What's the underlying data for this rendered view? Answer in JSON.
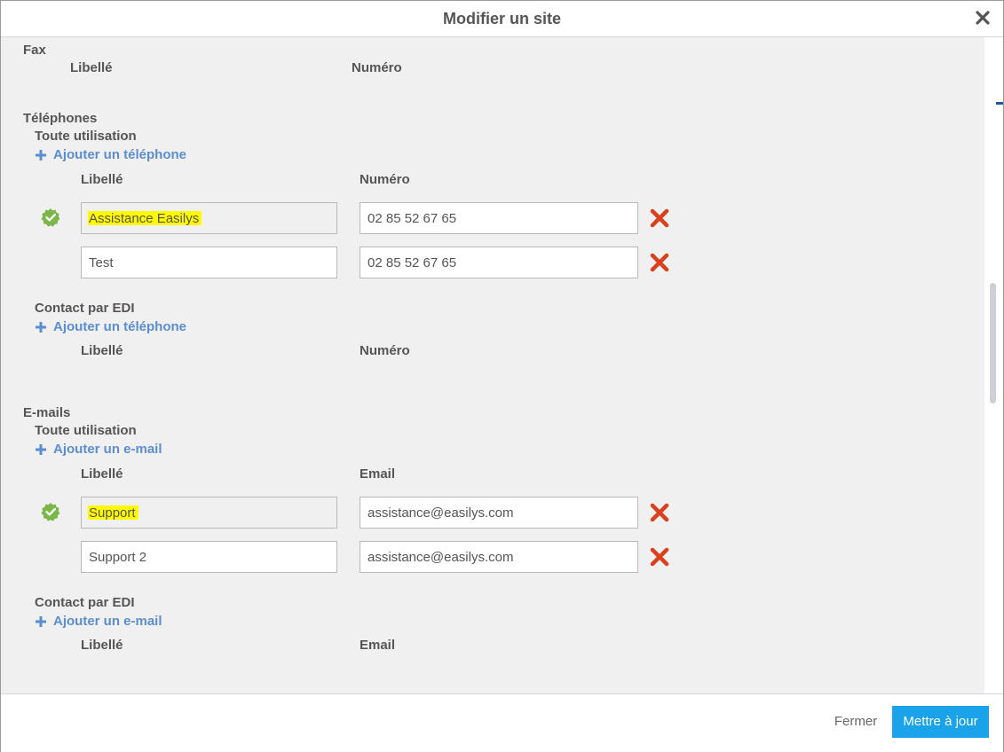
{
  "modal": {
    "title": "Modifier un site"
  },
  "fax": {
    "section": "Fax",
    "col_label": "Libellé",
    "col_number": "Numéro"
  },
  "phones": {
    "section": "Téléphones",
    "general": {
      "title": "Toute utilisation",
      "add": "Ajouter un téléphone",
      "col_label": "Libellé",
      "col_number": "Numéro",
      "rows": [
        {
          "label": "Assistance Easilys",
          "number": "02 85 52 67 65",
          "primary": true
        },
        {
          "label": "Test",
          "number": "02 85 52 67 65",
          "primary": false
        }
      ]
    },
    "edi": {
      "title": "Contact par EDI",
      "add": "Ajouter un téléphone",
      "col_label": "Libellé",
      "col_number": "Numéro"
    }
  },
  "emails": {
    "section": "E-mails",
    "general": {
      "title": "Toute utilisation",
      "add": "Ajouter un e-mail",
      "col_label": "Libellé",
      "col_email": "Email",
      "rows": [
        {
          "label": "Support",
          "email": "assistance@easilys.com",
          "primary": true
        },
        {
          "label": "Support 2",
          "email": "assistance@easilys.com",
          "primary": false
        }
      ]
    },
    "edi": {
      "title": "Contact par EDI",
      "add": "Ajouter un e-mail",
      "col_label": "Libellé",
      "col_email": "Email"
    }
  },
  "footer": {
    "close_label": "Fermer",
    "update_label": "Mettre à jour"
  },
  "colors": {
    "accent": "#1aa3e8",
    "link": "#5b8dd0",
    "delete": "#d9411e",
    "check": "#7ab648",
    "highlight": "#fffc00"
  },
  "icons": [
    "close-icon",
    "plus-icon",
    "check-badge-icon",
    "delete-x-icon"
  ]
}
